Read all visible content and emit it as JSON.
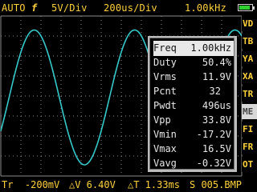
{
  "top_bar": {
    "trigger_mode": "AUTO",
    "trigger_edge": "f",
    "volts_per_div": "5V/Div",
    "time_per_div": "200us/Div",
    "frequency": "1.00kHz",
    "battery_level_percent": 85
  },
  "side_menu": {
    "items": [
      {
        "label": "VD"
      },
      {
        "label": "TB"
      },
      {
        "label": "YA"
      },
      {
        "label": "XA"
      },
      {
        "label": "TR"
      },
      {
        "label": "ME"
      },
      {
        "label": "FI"
      },
      {
        "label": "FR"
      },
      {
        "label": "OT"
      }
    ],
    "selected_index": 5
  },
  "measurements": [
    {
      "label": "Freq",
      "value": "1.00kHz"
    },
    {
      "label": "Duty",
      "value": "50.4%"
    },
    {
      "label": "Vrms",
      "value": "11.9V"
    },
    {
      "label": "Pcnt",
      "value": "32"
    },
    {
      "label": "Pwdt",
      "value": "496us"
    },
    {
      "label": "Vpp",
      "value": "33.8V"
    },
    {
      "label": "Vmin",
      "value": "-17.2V"
    },
    {
      "label": "Vmax",
      "value": "16.5V"
    },
    {
      "label": "Vavg",
      "value": "-0.32V"
    }
  ],
  "bottom_bar": {
    "trigger_level": "Tr  -200mV",
    "delta_v": "△V 6.40V",
    "delta_t": "△T 1.33ms",
    "save_status": "S 005.BMP"
  },
  "colors": {
    "accent_yellow": "#ffd23c",
    "trace_cyan": "#35c8c8",
    "grid_gray": "#8a8a8a",
    "selected_menu_bg": "#d8d8d8"
  },
  "waveform": {
    "type": "sine",
    "frequency_hz": 1000,
    "vmin_v": -17.2,
    "vmax_v": 16.5,
    "volts_per_div": 5,
    "us_per_div": 200
  }
}
